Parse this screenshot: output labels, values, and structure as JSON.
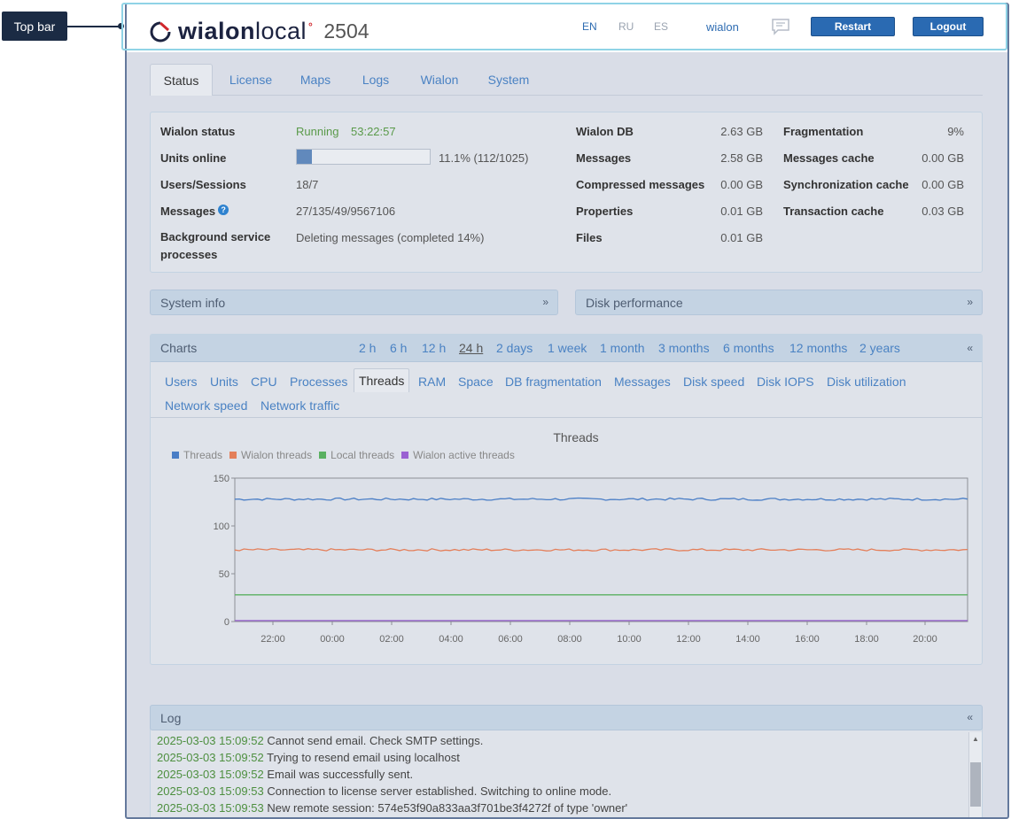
{
  "callout": {
    "label": "Top bar"
  },
  "topbar": {
    "logo_word_bold": "wialon",
    "logo_word_light": "local",
    "logo_sup": "°",
    "logo_number": "2504",
    "languages": [
      "EN",
      "RU",
      "ES"
    ],
    "active_language": "EN",
    "user": "wialon",
    "restart_label": "Restart",
    "logout_label": "Logout"
  },
  "tabs": [
    "Status",
    "License",
    "Maps",
    "Logs",
    "Wialon",
    "System"
  ],
  "status": {
    "wialon_status_label": "Wialon status",
    "wialon_status_value": "Running",
    "uptime": "53:22:57",
    "units_online_label": "Units online",
    "units_online_value": "11.1% (112/1025)",
    "units_online_fraction": 0.111,
    "users_sessions_label": "Users/Sessions",
    "users_sessions_value": "18/7",
    "messages_label": "Messages",
    "messages_value": "27/135/49/9567106",
    "bg_label": "Background service processes",
    "bg_value": "Deleting messages (completed 14%)",
    "db_rows": [
      {
        "label": "Wialon DB",
        "value": "2.63 GB"
      },
      {
        "label": "Messages",
        "value": "2.58 GB"
      },
      {
        "label": "Compressed messages",
        "value": "0.00 GB"
      },
      {
        "label": "Properties",
        "value": "0.01 GB"
      },
      {
        "label": "Files",
        "value": "0.01 GB"
      }
    ],
    "cache_rows": [
      {
        "label": "Fragmentation",
        "value": "9%"
      },
      {
        "label": "Messages cache",
        "value": "0.00 GB"
      },
      {
        "label": "Synchronization cache",
        "value": "0.00 GB"
      },
      {
        "label": "Transaction cache",
        "value": "0.03 GB"
      }
    ]
  },
  "system_info": {
    "title": "System info"
  },
  "disk_performance": {
    "title": "Disk performance"
  },
  "charts": {
    "title": "Charts",
    "ranges": [
      "2 h",
      "6 h",
      "12 h",
      "24 h",
      "2 days",
      "1 week",
      "1 month",
      "3 months",
      "6 months",
      "12 months",
      "2 years"
    ],
    "active_range": "24 h",
    "chart_tabs": [
      "Users",
      "Units",
      "CPU",
      "Processes",
      "Threads",
      "RAM",
      "Space",
      "DB fragmentation",
      "Messages",
      "Disk speed",
      "Disk IOPS",
      "Disk utilization",
      "Network speed",
      "Network traffic"
    ],
    "active_tab": "Threads"
  },
  "chart_data": {
    "type": "line",
    "title": "Threads",
    "legend_position": "top-left",
    "x_ticks": [
      "22:00",
      "00:00",
      "02:00",
      "04:00",
      "06:00",
      "08:00",
      "10:00",
      "12:00",
      "14:00",
      "16:00",
      "18:00",
      "20:00"
    ],
    "y_ticks": [
      0,
      50,
      100,
      150
    ],
    "ylim": [
      0,
      150
    ],
    "grid": false,
    "series": [
      {
        "name": "Threads",
        "color": "#4a7ec6",
        "value": 128
      },
      {
        "name": "Wialon threads",
        "color": "#e47f5a",
        "value": 75
      },
      {
        "name": "Local threads",
        "color": "#5ab061",
        "value": 28
      },
      {
        "name": "Wialon active threads",
        "color": "#9a62d2",
        "value": 1
      }
    ]
  },
  "log": {
    "title": "Log",
    "entries": [
      {
        "time": "2025-03-03 15:09:52",
        "text": "Cannot send email. Check SMTP settings."
      },
      {
        "time": "2025-03-03 15:09:52",
        "text": "Trying to resend email using localhost"
      },
      {
        "time": "2025-03-03 15:09:52",
        "text": "Email was successfully sent."
      },
      {
        "time": "2025-03-03 15:09:53",
        "text": "Connection to license server established. Switching to online mode."
      },
      {
        "time": "2025-03-03 15:09:53",
        "text": "New remote session: 574e53f90a833aa3f701be3f4272f of type 'owner'"
      }
    ]
  }
}
